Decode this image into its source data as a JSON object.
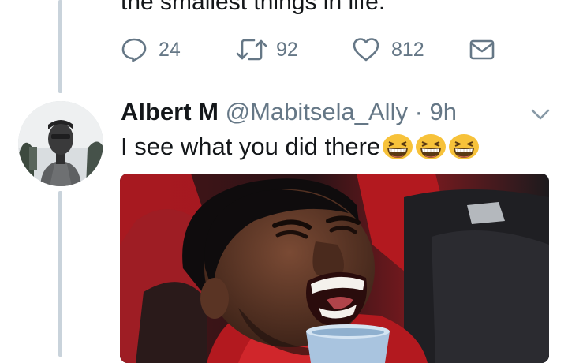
{
  "previous_tweet": {
    "text_tail": "the smallest things in life.",
    "actions": {
      "reply_count": "24",
      "retweet_count": "92",
      "like_count": "812"
    }
  },
  "tweet": {
    "display_name": "Albert M",
    "handle": "@Mabitsela_Ally",
    "separator": "·",
    "time": "9h",
    "text": "I see what you did there",
    "emoji": [
      "grinning-squint-face",
      "grinning-squint-face",
      "grinning-squint-face"
    ]
  },
  "colors": {
    "secondary_text": "#657786",
    "thread_line": "#c9d3db",
    "emoji_yellow": "#f7c23a",
    "jersey_red": "#c8191f"
  }
}
